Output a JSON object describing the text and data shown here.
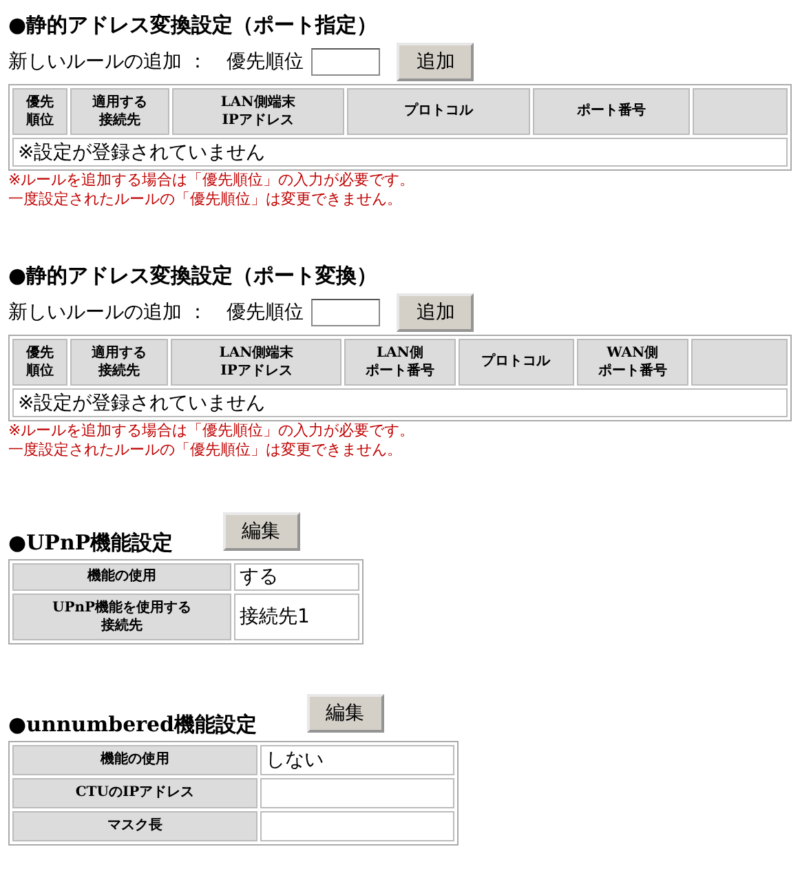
{
  "nat_sections": [
    {
      "title": "●静的アドレス変換設定（ポート指定）",
      "add_label": "新しいルールの追加 ：",
      "priority_label": "優先順位",
      "add_button": "追加",
      "columns": [
        {
          "lines": [
            "優先",
            "順位"
          ]
        },
        {
          "lines": [
            "適用する",
            "接続先"
          ]
        },
        {
          "lines": [
            "LAN側端末",
            "IPアドレス"
          ]
        },
        {
          "lines": [
            "プロトコル"
          ]
        },
        {
          "lines": [
            "ポート番号"
          ]
        },
        {}
      ],
      "empty_message": "※設定が登録されていません",
      "notes": [
        "※ルールを追加する場合は「優先順位」の入力が必要です。",
        "一度設定されたルールの「優先順位」は変更できません。"
      ]
    },
    {
      "title": "●静的アドレス変換設定（ポート変換）",
      "add_label": "新しいルールの追加 ：",
      "priority_label": "優先順位",
      "add_button": "追加",
      "columns": [
        {
          "lines": [
            "優先",
            "順位"
          ]
        },
        {
          "lines": [
            "適用する",
            "接続先"
          ]
        },
        {
          "lines": [
            "LAN側端末",
            "IPアドレス"
          ]
        },
        {
          "lines": [
            "LAN側",
            "ポート番号"
          ]
        },
        {
          "lines": [
            "プロトコル"
          ]
        },
        {
          "lines": [
            "WAN側",
            "ポート番号"
          ]
        },
        {}
      ],
      "empty_message": "※設定が登録されていません",
      "notes": [
        "※ルールを追加する場合は「優先順位」の入力が必要です。",
        "一度設定されたルールの「優先順位」は変更できません。"
      ]
    }
  ],
  "setting_sections": [
    {
      "title": "●UPnP機能設定",
      "edit_button": "編集",
      "rows": [
        {
          "lines": [
            "機能の使用"
          ],
          "value": "する"
        },
        {
          "lines": [
            "UPnP機能を使用する",
            "接続先"
          ],
          "value": "接続先1"
        }
      ]
    },
    {
      "title": "●unnumbered機能設定",
      "edit_button": "編集",
      "rows": [
        {
          "lines": [
            "機能の使用"
          ],
          "value": "しない"
        },
        {
          "lines": [
            "CTUのIPアドレス"
          ]
        },
        {
          "lines": [
            "マスク長"
          ]
        }
      ]
    }
  ]
}
